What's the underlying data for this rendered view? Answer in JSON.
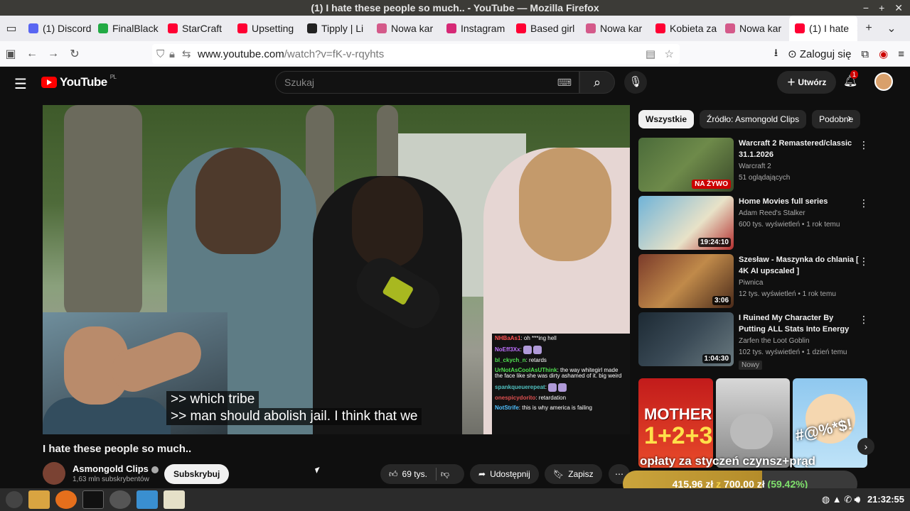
{
  "window": {
    "title": "(1) I hate these people so much.. - YouTube — Mozilla Firefox"
  },
  "tabs": [
    {
      "label": "(1) Discord",
      "color": "#5865f2"
    },
    {
      "label": "FinalBlack",
      "color": "#22aa44"
    },
    {
      "label": "StarCraft",
      "color": "#ff0033"
    },
    {
      "label": "Upsetting",
      "color": "#ff0033"
    },
    {
      "label": "Tipply | Li",
      "color": "#222222"
    },
    {
      "label": "Nowa kar",
      "color": "#d45a8a"
    },
    {
      "label": "Instagram",
      "color": "#d62976"
    },
    {
      "label": "Based girl",
      "color": "#ff0033"
    },
    {
      "label": "Nowa kar",
      "color": "#d45a8a"
    },
    {
      "label": "Kobieta za",
      "color": "#ff0033"
    },
    {
      "label": "Nowa kar",
      "color": "#d45a8a"
    },
    {
      "label": "(1) I hate",
      "color": "#ff0033",
      "active": true
    }
  ],
  "nav": {
    "url_host": "www.youtube.com",
    "url_path": "/watch?v=fK-v-rqyhts",
    "login": "Zaloguj się"
  },
  "youtube": {
    "logo": "YouTube",
    "region": "PL",
    "search_placeholder": "Szukaj",
    "create": "Utwórz",
    "notif_count": "1"
  },
  "video": {
    "title": "I hate these people so much..",
    "subtitle_line1": ">> which tribe",
    "subtitle_line2": ">> man should abolish jail. I think that we",
    "channel": "Asmongold Clips",
    "subscribers": "1,63 mln subskrybentów",
    "subscribe": "Subskrybuj",
    "likes": "69 tys.",
    "share": "Udostępnij",
    "save": "Zapisz"
  },
  "chat": [
    {
      "user": "NHBaAs1",
      "text": "oh ***ing hell",
      "color": "#ff5050"
    },
    {
      "user": "NoEff3Xx",
      "text": "",
      "color": "#c070ff"
    },
    {
      "user": "bl_ckych_n",
      "text": "retards",
      "color": "#50e050"
    },
    {
      "user": "UrNotAsCoolAsUThink",
      "text": "the way whitegirl made the face like she was dirty ashamed of it. big weird",
      "color": "#50e050"
    },
    {
      "user": "spankqueuerepeat",
      "text": "",
      "color": "#50c0c0"
    },
    {
      "user": "onespicydorito",
      "text": "retardation",
      "color": "#e05050"
    },
    {
      "user": "NotStrife",
      "text": "this is why america is failing",
      "color": "#50c0ff"
    }
  ],
  "chips": [
    "Wszystkie",
    "Źródło: Asmongold Clips",
    "Podobne"
  ],
  "recommendations": [
    {
      "title": "Warcraft 2 Remastered/classic 31.1.2026",
      "channel": "Warcraft 2",
      "stats": "51 oglądających",
      "badge": "NA ŻYWO",
      "live": true
    },
    {
      "title": "Home Movies full series",
      "channel": "Adam Reed's Stalker",
      "stats": "600 tys. wyświetleń • 1 rok temu",
      "badge": "19:24:10"
    },
    {
      "title": "Szesław - Maszynka do chlania [ 4K AI upscaled ]",
      "channel": "Piwnica",
      "stats": "12 tys. wyświetleń • 1 rok temu",
      "badge": "3:06"
    },
    {
      "title": "I Ruined My Character By Putting ALL Stats Into Energy",
      "channel": "Zarfen the Loot Goblin",
      "stats": "102 tys. wyświetleń • 1 dzień temu",
      "badge": "1:04:30",
      "new": "Nowy"
    }
  ],
  "shorts": {
    "overlay": "opłaty za styczeń czynsz+prąd",
    "overlay2": "#@%*$!",
    "label_mother": "MOTHER",
    "label_123": "1+2+3"
  },
  "donation": {
    "current": "415,96 zł",
    "of": "z",
    "goal": "700,00 zł",
    "percent": "(59.42%)",
    "progress": 0.5942
  },
  "taskbar": {
    "clock": "21:32:55"
  }
}
